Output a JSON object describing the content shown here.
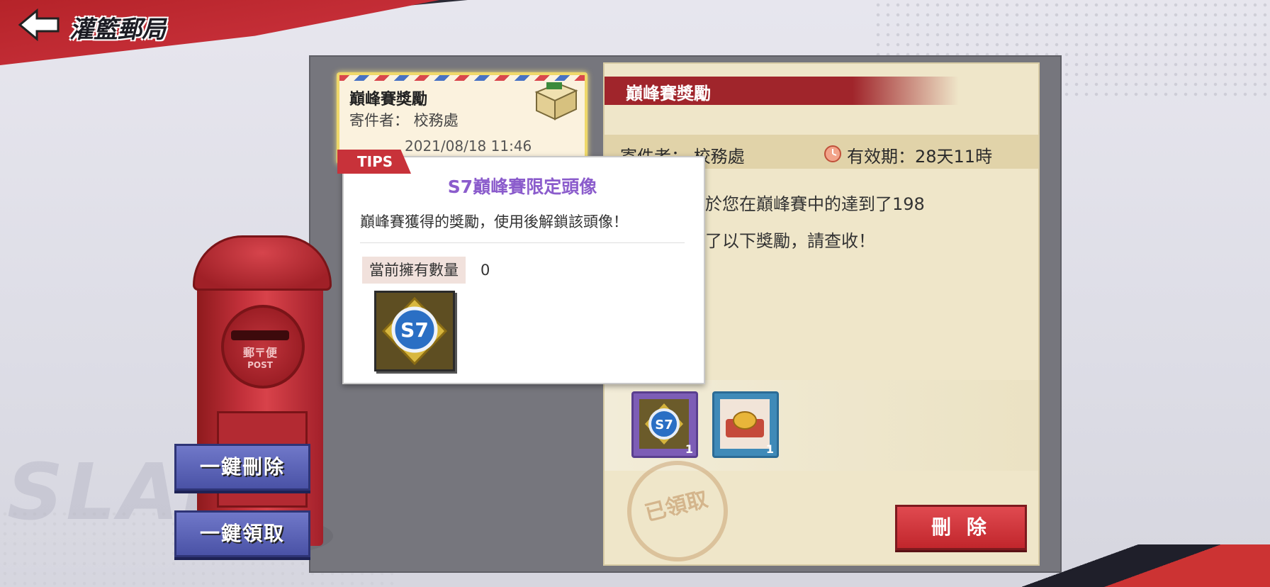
{
  "header": {
    "title": "灌籃郵局",
    "back_icon": "back-arrow-icon"
  },
  "mail_list": [
    {
      "title": "巔峰賽獎勵",
      "sender": "寄件者： 校務處",
      "date": "2021/08/18 11:46",
      "icon": "parcel-icon",
      "highlight_color": "#efd86a"
    }
  ],
  "detail": {
    "title": "巔峰賽獎勵",
    "sender": "寄件者： 校務處",
    "expiry": "有效期：28天11時",
    "body_line1": "家你好，由於您在巔峰賽中的達到了198",
    "body_line2": "表現，獲得了以下獎勵，請查收！",
    "rewards": [
      {
        "name": "S7 avatar badge",
        "count": "1",
        "frame_color": "#7d5db6",
        "icon": "s7-badge-icon"
      },
      {
        "name": "gold item",
        "count": "1",
        "frame_color": "#3f8ab8",
        "icon": "gold-trophy-icon"
      }
    ],
    "claimed_stamp": "已領取",
    "delete_label": "刪 除"
  },
  "side_buttons": {
    "delete_all": "一鍵刪除",
    "claim_all": "一鍵領取"
  },
  "mailbox": {
    "label": "郵〒便",
    "sublabel": "POST"
  },
  "watermark": "SLAM DUNK",
  "tips": {
    "tag": "TIPS",
    "title": "S7巔峰賽限定頭像",
    "description": "巔峰賽獲得的獎勵，使用後解鎖該頭像！",
    "count_label": "當前擁有數量",
    "count_value": "0",
    "title_color": "#8b5ccc"
  },
  "colors": {
    "accent_red": "#b52329",
    "button_blue": "#4a52a6",
    "panel_bg": "#efe6c9"
  }
}
